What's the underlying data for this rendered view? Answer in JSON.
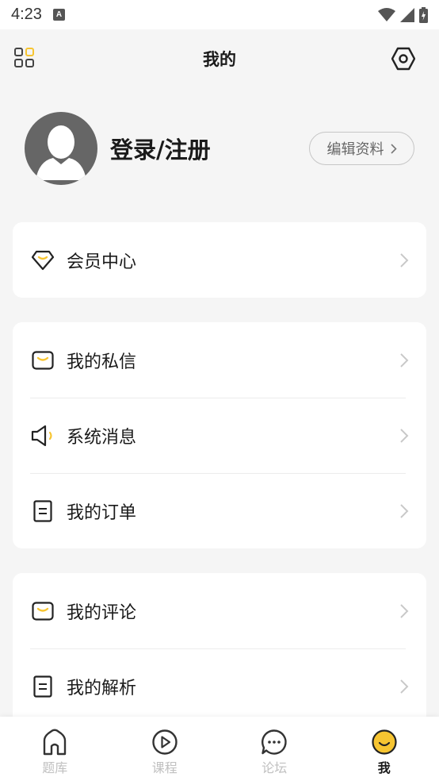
{
  "status_bar": {
    "time": "4:23",
    "notification_letter": "A"
  },
  "header": {
    "title": "我的"
  },
  "profile": {
    "login_label": "登录/注册",
    "edit_label": "编辑资料"
  },
  "cards": [
    {
      "items": [
        {
          "label": "会员中心",
          "icon": "diamond-icon"
        }
      ]
    },
    {
      "items": [
        {
          "label": "我的私信",
          "icon": "message-icon"
        },
        {
          "label": "系统消息",
          "icon": "speaker-icon"
        },
        {
          "label": "我的订单",
          "icon": "document-icon"
        }
      ]
    },
    {
      "items": [
        {
          "label": "我的评论",
          "icon": "message-icon"
        },
        {
          "label": "我的解析",
          "icon": "document-icon"
        }
      ]
    }
  ],
  "tabbar": {
    "tabs": [
      {
        "label": "题库",
        "icon": "home-icon",
        "active": false
      },
      {
        "label": "课程",
        "icon": "play-icon",
        "active": false
      },
      {
        "label": "论坛",
        "icon": "chat-icon",
        "active": false
      },
      {
        "label": "我",
        "icon": "smile-icon",
        "active": true
      }
    ]
  },
  "colors": {
    "accent": "#f7c531",
    "text": "#1a1a1a",
    "muted": "#c0c0c0",
    "background": "#f5f5f5"
  }
}
